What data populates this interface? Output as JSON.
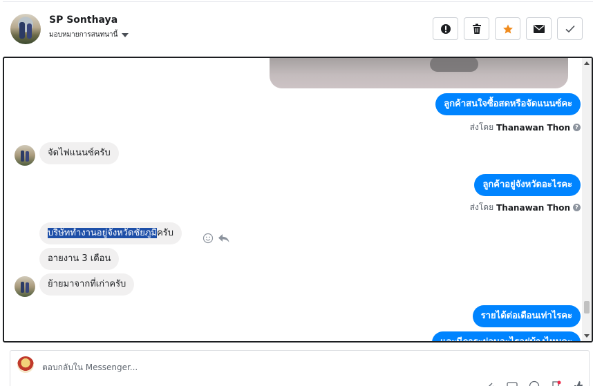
{
  "header": {
    "name": "SP Sonthaya",
    "subtitle": "มอบหมายการสนทนานี้",
    "buttons": [
      {
        "icon": "alert-icon",
        "label": "!"
      },
      {
        "icon": "trash-icon",
        "label": ""
      },
      {
        "icon": "star-icon",
        "label": "★",
        "color": "#f08b1d"
      },
      {
        "icon": "mail-icon",
        "label": ""
      },
      {
        "icon": "check-icon",
        "label": "✓"
      }
    ]
  },
  "messages": {
    "m1": {
      "text": "ลูกค้าสนใจซื้อสดหรือจัดแนนซ์คะ",
      "direction": "outgoing"
    },
    "m1_sent_prefix": "ส่งโดย",
    "m1_sender": "Thanawan Thon",
    "m2": {
      "text": "จัดไฟแนนซ์ครับ",
      "direction": "incoming"
    },
    "m3": {
      "text": "ลูกค้าอยู่จังหวัดอะไรคะ",
      "direction": "outgoing"
    },
    "m3_sent_prefix": "ส่งโดย",
    "m3_sender": "Thanawan Thon",
    "m4_selected": "บริษัททำงานอยู่จังหวัดชัยภูมิ",
    "m4_rest": "ครับ",
    "m5": {
      "text": "อายงาน 3 เดือน",
      "direction": "incoming"
    },
    "m6": {
      "text": "ย้ายมาจากที่เก่าครับ",
      "direction": "incoming"
    },
    "m7": {
      "text": "รายได้ต่อเดือนเท่าไรคะ",
      "direction": "outgoing"
    },
    "m8": {
      "text": "และมีภาระผ่อนอะไรอยู่บ้างไหมคะ",
      "direction": "outgoing"
    }
  },
  "reply": {
    "placeholder": "ตอบกลับใน Messenger..."
  },
  "colors": {
    "outgoing_bubble": "#0084ff",
    "incoming_bubble": "#f1f0f0",
    "selection": "#1d4fa8"
  }
}
